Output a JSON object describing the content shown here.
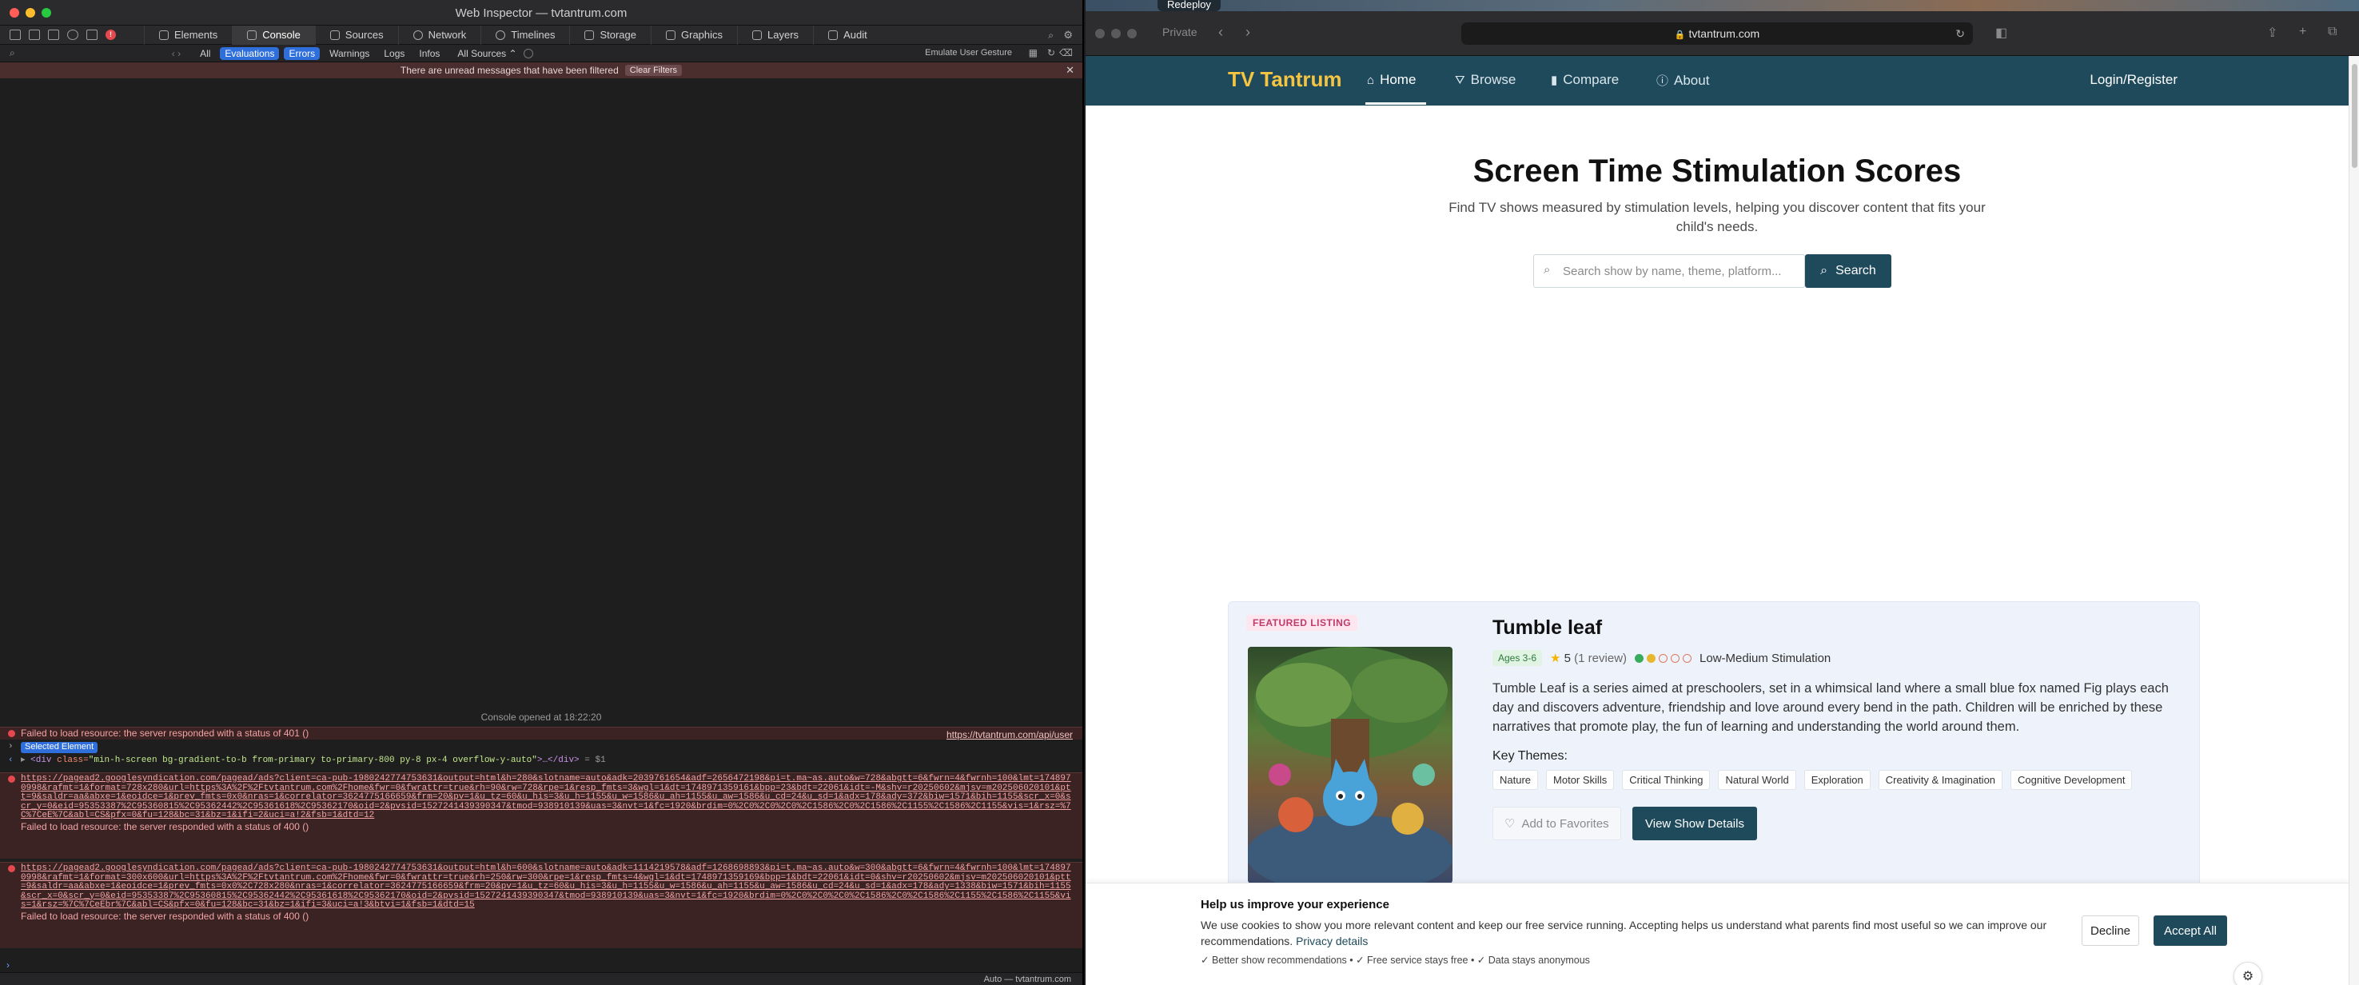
{
  "inspector": {
    "window_title": "Web Inspector — tvtantrum.com",
    "tabs": [
      {
        "label": "Elements"
      },
      {
        "label": "Console"
      },
      {
        "label": "Sources"
      },
      {
        "label": "Network"
      },
      {
        "label": "Timelines"
      },
      {
        "label": "Storage"
      },
      {
        "label": "Graphics"
      },
      {
        "label": "Layers"
      },
      {
        "label": "Audit"
      }
    ],
    "filters": {
      "all": "All",
      "evaluations": "Evaluations",
      "errors": "Errors",
      "warnings": "Warnings",
      "logs": "Logs",
      "infos": "Infos",
      "sources": "All Sources ⌃",
      "emulate": "Emulate User Gesture"
    },
    "notice": {
      "text": "There are unread messages that have been filtered",
      "clear": "Clear Filters"
    },
    "console_opened": "Console opened at 18:22:20",
    "log1": {
      "message": "Failed to load resource: the server responded with a status of 401 ()",
      "source": "https://tvtantrum.com/api/user"
    },
    "selected_badge": "Selected Element",
    "dom_line": {
      "tag_open": "<div",
      "attr": "class=",
      "value": "\"min-h-screen bg-gradient-to-b from-primary to-primary-800 py-8 px-4 overflow-y-auto\"",
      "rest": ">…</div>",
      "ref": "= $1"
    },
    "log2": {
      "url": "https://pagead2.googlesyndication.com/pagead/ads?client=ca-pub-1980242774753631&output=html&h=280&slotname=auto&adk=2039761654&adf=2656472198&pi=t.ma~as.auto&w=728&abgtt=6&fwrn=4&fwrnh=100&lmt=1748970998&rafmt=1&format=728x280&url=https%3A%2F%2Ftvtantrum.com%2Fhome&fwr=0&fwrattr=true&rh=90&rw=728&rpe=1&resp_fmts=3&wgl=1&dt=1748971359161&bpp=23&bdt=22061&idt=-M&shv=r20250602&mjsv=m202506020101&ptt=9&saldr=aa&abxe=1&eoidce=1&prev_fmts=0x0&nras=1&correlator=3624775166659&frm=20&pv=1&u_tz=60&u_his=3&u_h=1155&u_w=1586&u_ah=1155&u_aw=1586&u_cd=24&u_sd=1&adx=178&ady=372&biw=1571&bih=1155&scr_x=0&scr_y=0&eid=95353387%2C95360815%2C95362442%2C95361618%2C95362170&oid=2&pvsid=1527241439390347&tmod=938910139&uas=3&nvt=1&fc=1920&brdim=0%2C0%2C0%2C0%2C1586%2C0%2C1586%2C1155%2C1586%2C1155&vis=1&rsz=%7C%7CeE%7C&abl=CS&pfx=0&fu=128&bc=31&bz=1&ifi=2&uci=a!2&fsb=1&dtd=12",
      "message": "Failed to load resource: the server responded with a status of 400 ()"
    },
    "log3": {
      "url": "https://pagead2.googlesyndication.com/pagead/ads?client=ca-pub-1980242774753631&output=html&h=600&slotname=auto&adk=1114219578&adf=1268698893&pi=t.ma~as.auto&w=300&abgtt=6&fwrn=4&fwrnh=100&lmt=1748970998&rafmt=1&format=300x600&url=https%3A%2F%2Ftvtantrum.com%2Fhome&fwr=0&fwrattr=true&rh=250&rw=300&rpe=1&resp_fmts=4&wgl=1&dt=1748971359169&bpp=1&bdt=22061&idt=0&shv=r20250602&mjsv=m202506020101&ptt=9&saldr=aa&abxe=1&eoidce=1&prev_fmts=0x0%2C728x280&nras=1&correlator=3624775166659&frm=20&pv=1&u_tz=60&u_his=3&u_h=1155&u_w=1586&u_ah=1155&u_aw=1586&u_cd=24&u_sd=1&adx=178&ady=1338&biw=1571&bih=1155&scr_x=0&scr_y=0&eid=95353387%2C95360815%2C95362442%2C95361618%2C95362170&oid=2&pvsid=1527241439390347&tmod=938910139&uas=3&nvt=1&fc=1920&brdim=0%2C0%2C0%2C0%2C1586%2C0%2C1586%2C1155%2C1586%2C1155&vis=1&rsz=%7C%7CeEbr%7C&abl=CS&pfx=0&fu=128&bc=31&bz=1&ifi=3&uci=a!3&btvi=1&fsb=1&dtd=15",
      "message": "Failed to load resource: the server responded with a status of 400 ()"
    },
    "status": "Auto — tvtantrum.com"
  },
  "browser": {
    "desktop_tab": "Redeploy",
    "private_label": "Private",
    "url": "tvtantrum.com",
    "page": {
      "brand": "TV Tantrum",
      "nav": [
        {
          "label": "Home",
          "icon": "⌂"
        },
        {
          "label": "Browse",
          "icon": "⛛"
        },
        {
          "label": "Compare",
          "icon": "▮"
        },
        {
          "label": "About",
          "icon": "ⓘ"
        }
      ],
      "login": "Login/Register",
      "hero_title": "Screen Time Stimulation Scores",
      "hero_subtitle": "Find TV shows measured by stimulation levels, helping you discover content that fits your child's needs.",
      "search_placeholder": "Search show by name, theme, platform...",
      "search_button": "Search",
      "featured": {
        "label": "FEATURED LISTING",
        "title": "Tumble leaf",
        "age": "Ages 3-6",
        "rating": "5",
        "reviews": "(1 review)",
        "stimulation_label": "Low-Medium Stimulation",
        "stimulation_level": 2,
        "stimulation_max": 5,
        "description": "Tumble Leaf is a series aimed at preschoolers, set in a whimsical land where a small blue fox named Fig plays each day and discovers adventure, friendship and love around every bend in the path. Children will be enriched by these narratives that promote play, the fun of learning and understanding the world around them.",
        "themes_label": "Key Themes:",
        "themes": [
          "Nature",
          "Motor Skills",
          "Critical Thinking",
          "Natural World",
          "Exploration",
          "Creativity & Imagination",
          "Cognitive Development"
        ],
        "favorite_button": "Add to Favorites",
        "details_button": "View Show Details"
      },
      "cookie": {
        "title": "Help us improve your experience",
        "body": "We use cookies to show you more relevant content and keep our free service running. Accepting helps us understand what parents find most useful so we can improve our recommendations.",
        "link": "Privacy details",
        "footer": "✓ Better show recommendations • ✓ Free service stays free • ✓ Data stays anonymous",
        "decline": "Decline",
        "accept": "Accept All"
      }
    }
  },
  "colors": {
    "primary": "#1f4a5c",
    "brand_yellow": "#f5c542",
    "featured_bg": "#eef2fb",
    "error_row": "#3b2324"
  }
}
